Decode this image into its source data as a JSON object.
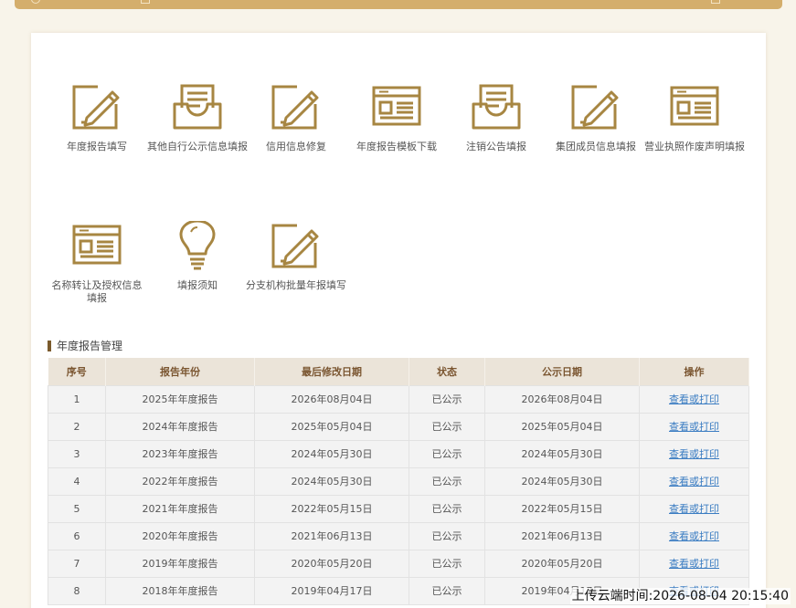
{
  "colors": {
    "accent": "#a78642",
    "topbar": "#d4ae6c",
    "link": "#3a7cc2"
  },
  "functions": [
    {
      "label": "年度报告填写",
      "icon": "pencil-edit-icon"
    },
    {
      "label": "其他自行公示信息填报",
      "icon": "inbox-tray-icon"
    },
    {
      "label": "信用信息修复",
      "icon": "pencil-edit-icon"
    },
    {
      "label": "年度报告模板下载",
      "icon": "web-window-icon"
    },
    {
      "label": "注销公告填报",
      "icon": "inbox-tray-icon"
    },
    {
      "label": "集团成员信息填报",
      "icon": "pencil-edit-icon"
    },
    {
      "label": "营业执照作废声明填报",
      "icon": "web-window-icon"
    },
    {
      "label": "名称转让及授权信息填报",
      "icon": "web-window-icon"
    },
    {
      "label": "填报须知",
      "icon": "lightbulb-icon"
    },
    {
      "label": "分支机构批量年报填写",
      "icon": "pencil-edit-icon"
    }
  ],
  "section_title": "年度报告管理",
  "table": {
    "headers": [
      "序号",
      "报告年份",
      "最后修改日期",
      "状态",
      "公示日期",
      "操作"
    ],
    "rows": [
      {
        "no": "1",
        "year": "2025年年度报告",
        "modified": "2026年08月04日",
        "status": "已公示",
        "published": "2026年08月04日",
        "action": "查看或打印"
      },
      {
        "no": "2",
        "year": "2024年年度报告",
        "modified": "2025年05月04日",
        "status": "已公示",
        "published": "2025年05月04日",
        "action": "查看或打印"
      },
      {
        "no": "3",
        "year": "2023年年度报告",
        "modified": "2024年05月30日",
        "status": "已公示",
        "published": "2024年05月30日",
        "action": "查看或打印"
      },
      {
        "no": "4",
        "year": "2022年年度报告",
        "modified": "2024年05月30日",
        "status": "已公示",
        "published": "2024年05月30日",
        "action": "查看或打印"
      },
      {
        "no": "5",
        "year": "2021年年度报告",
        "modified": "2022年05月15日",
        "status": "已公示",
        "published": "2022年05月15日",
        "action": "查看或打印"
      },
      {
        "no": "6",
        "year": "2020年年度报告",
        "modified": "2021年06月13日",
        "status": "已公示",
        "published": "2021年06月13日",
        "action": "查看或打印"
      },
      {
        "no": "7",
        "year": "2019年年度报告",
        "modified": "2020年05月20日",
        "status": "已公示",
        "published": "2020年05月20日",
        "action": "查看或打印"
      },
      {
        "no": "8",
        "year": "2018年年度报告",
        "modified": "2019年04月17日",
        "status": "已公示",
        "published": "2019年04月17日",
        "action": "查看或打印"
      }
    ]
  },
  "watermark": "上传云端时间:2026-08-04 20:15:40"
}
